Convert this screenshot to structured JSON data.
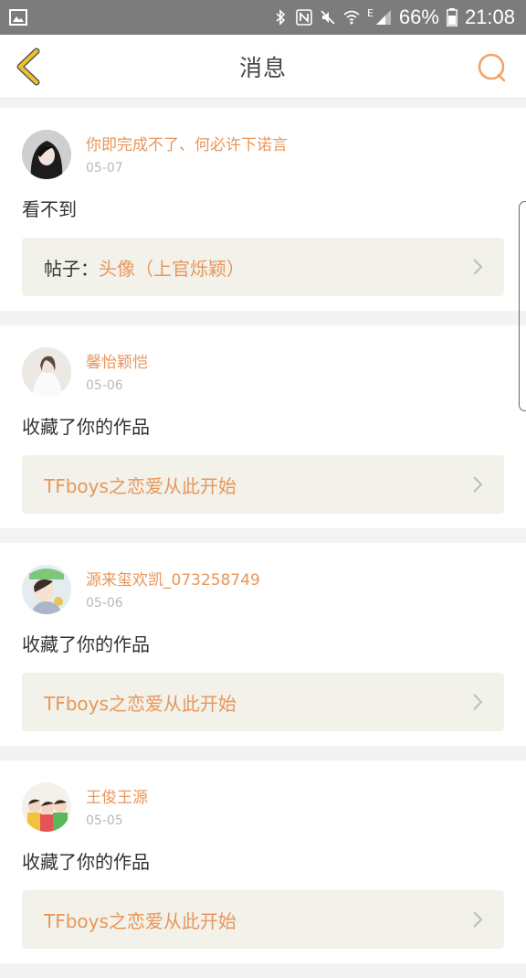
{
  "status_bar": {
    "icons": [
      "image-icon",
      "bluetooth-icon",
      "nfc-icon",
      "mute-icon",
      "wifi-icon",
      "signal-icon",
      "battery-icon"
    ],
    "network_letter": "E",
    "battery_percent": "66%",
    "time": "21:08"
  },
  "header": {
    "title": "消息",
    "back_icon": "chevron-left-icon",
    "search_icon": "search-icon"
  },
  "colors": {
    "accent": "#e8965a",
    "back_arrow": "#f0c02f",
    "post_bg": "#f2f2ea"
  },
  "notifications": [
    {
      "username": "你即完成不了、何必许下诺言",
      "date": "05-07",
      "message": "看不到",
      "post_prefix": "帖子：",
      "post_title": "头像（上官烁颖）"
    },
    {
      "username": "馨怡颖恺",
      "date": "05-06",
      "message": "收藏了你的作品",
      "post_prefix": "",
      "post_title": "TFboys之恋爱从此开始"
    },
    {
      "username": "源来玺欢凯_073258749",
      "date": "05-06",
      "message": "收藏了你的作品",
      "post_prefix": "",
      "post_title": "TFboys之恋爱从此开始"
    },
    {
      "username": "王俊王源",
      "date": "05-05",
      "message": "收藏了你的作品",
      "post_prefix": "",
      "post_title": "TFboys之恋爱从此开始"
    }
  ]
}
